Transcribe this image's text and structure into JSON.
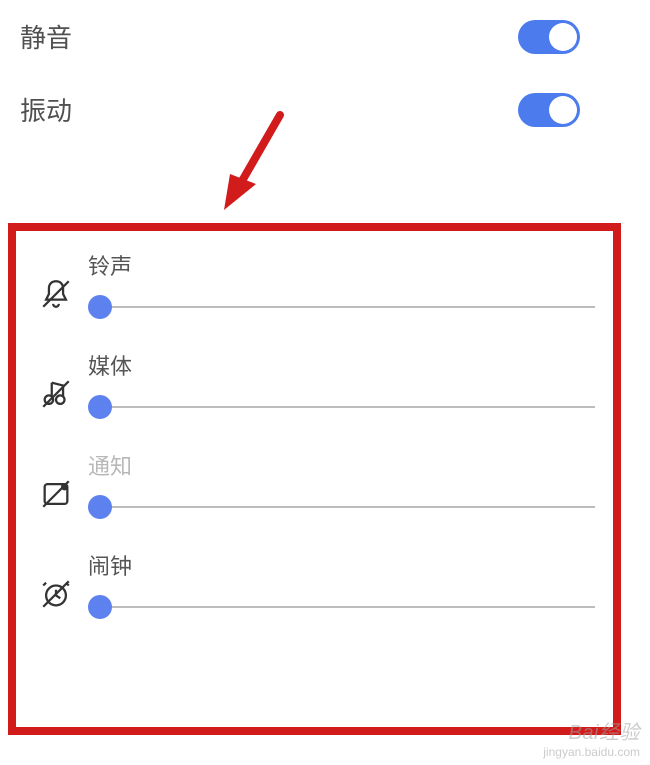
{
  "toggles": {
    "mute": {
      "label": "静音",
      "on": true
    },
    "vibrate": {
      "label": "振动",
      "on": true
    }
  },
  "sliders": {
    "ringtone": {
      "label": "铃声",
      "value": 0,
      "disabled": false
    },
    "media": {
      "label": "媒体",
      "value": 0,
      "disabled": false
    },
    "notification": {
      "label": "通知",
      "value": 0,
      "disabled": true
    },
    "alarm": {
      "label": "闹钟",
      "value": 0,
      "disabled": false
    }
  },
  "colors": {
    "accent": "#5d82ef",
    "toggle": "#4b7bec",
    "highlight_border": "#d21c1c",
    "arrow": "#d21c1c"
  },
  "watermark": {
    "line1": "Bai经验",
    "line2": "jingyan.baidu.com"
  }
}
